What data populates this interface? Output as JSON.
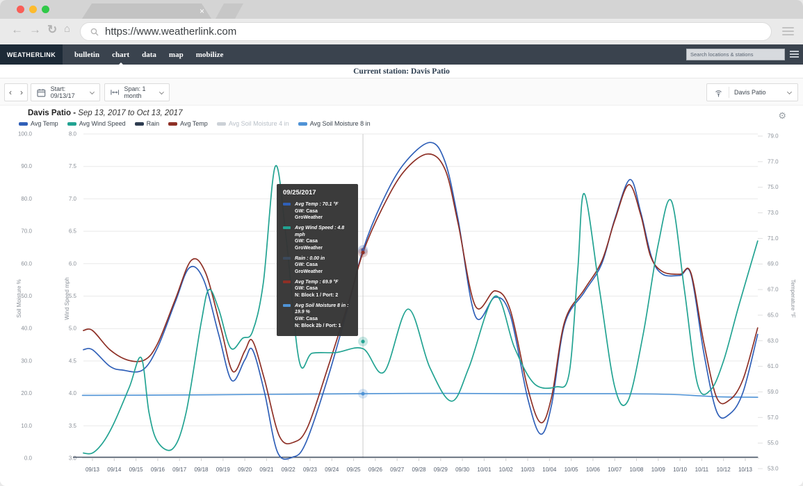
{
  "browser": {
    "url": "https://www.weatherlink.com",
    "tab_close": "×"
  },
  "nav": {
    "logo": "WEATHERLINK",
    "items": [
      {
        "label": "bulletin",
        "active": false
      },
      {
        "label": "chart",
        "active": true
      },
      {
        "label": "data",
        "active": false
      },
      {
        "label": "map",
        "active": false
      },
      {
        "label": "mobilize",
        "active": false
      }
    ],
    "search_placeholder": "Search locations & stations"
  },
  "station_bar": {
    "label": "Current station: Davis Patio"
  },
  "controls": {
    "prev": "‹",
    "next": "›",
    "start_label": "Start: 09/13/17",
    "span_label": "Span: 1 month",
    "station_label": "Davis Patio"
  },
  "chart_header": {
    "title": "Davis Patio - ",
    "subtitle": "Sep 13, 2017 to Oct 13, 2017",
    "gear": "⚙"
  },
  "legend": [
    {
      "label": "Avg Temp",
      "color": "#3060b8",
      "muted": false
    },
    {
      "label": "Avg Wind Speed",
      "color": "#22a392",
      "muted": false
    },
    {
      "label": "Rain",
      "color": "#2e3c50",
      "muted": false
    },
    {
      "label": "Avg Temp",
      "color": "#8e3026",
      "muted": false
    },
    {
      "label": "Avg Soil Moisture 4 in",
      "color": "#c6ccd3",
      "muted": true
    },
    {
      "label": "Avg Soil Moisture 8 in",
      "color": "#4f93d6",
      "muted": false
    }
  ],
  "tooltip": {
    "date": "09/25/2017",
    "entries": [
      {
        "color": "#3060b8",
        "label": "Avg Temp : 70.1 °F",
        "line2": "GW: Casa",
        "line3": "GroWeather"
      },
      {
        "color": "#22a392",
        "label": "Avg Wind Speed : 4.8 mph",
        "line2": "GW: Casa",
        "line3": "GroWeather"
      },
      {
        "color": "#3c4a5c",
        "label": "Rain : 0.00 in",
        "line2": "GW: Casa",
        "line3": "GroWeather"
      },
      {
        "color": "#8e3026",
        "label": "Avg Temp : 69.9 °F",
        "line2": "GW: Casa",
        "line3": "N: Block 1 / Port: 2"
      },
      {
        "color": "#4f93d6",
        "label": "Avg Soil Moisture 8 in : 19.9 %",
        "line2": "GW: Casa",
        "line3": "N: Block 2b / Port: 1"
      }
    ]
  },
  "chart_data": {
    "type": "line",
    "x_dates": [
      "09/13",
      "09/14",
      "09/15",
      "09/16",
      "09/17",
      "09/18",
      "09/19",
      "09/20",
      "09/21",
      "09/22",
      "09/23",
      "09/24",
      "09/25",
      "09/26",
      "09/27",
      "09/28",
      "09/29",
      "09/30",
      "10/01",
      "10/02",
      "10/03",
      "10/04",
      "10/05",
      "10/06",
      "10/07",
      "10/08",
      "10/09",
      "10/10",
      "10/11",
      "10/12",
      "10/13"
    ],
    "axes": {
      "soil": {
        "label": "Soil Moisture %",
        "range": [
          0,
          100
        ],
        "ticks": [
          "100.0",
          "90.0",
          "80.0",
          "70.0",
          "60.0",
          "50.0",
          "40.0",
          "30.0",
          "20.0",
          "10.0",
          "0.0"
        ]
      },
      "wind": {
        "label": "Wind Speed mph",
        "range": [
          3,
          8
        ],
        "ticks": [
          "8.0",
          "7.5",
          "7.0",
          "6.5",
          "6.0",
          "5.5",
          "5.0",
          "4.5",
          "4.0",
          "3.5",
          "3.0"
        ]
      },
      "temp": {
        "label": "Temperature °F",
        "range": [
          53,
          79
        ],
        "ticks": [
          "79.0",
          "77.0",
          "75.0",
          "73.0",
          "71.0",
          "69.0",
          "67.0",
          "65.0",
          "63.0",
          "61.0",
          "59.0",
          "57.0",
          "55.0",
          "53.0"
        ]
      }
    },
    "grid": true,
    "legend_position": "top-left",
    "series": [
      {
        "name": "Avg Soil Moisture 8 in",
        "axis": "soil",
        "color": "#4f93d6",
        "width": 1.6,
        "points": [
          [
            0,
            19.4
          ],
          [
            4,
            19.5
          ],
          [
            8,
            19.7
          ],
          [
            12.43,
            19.9
          ],
          [
            16,
            20.0
          ],
          [
            20,
            19.9
          ],
          [
            24,
            19.9
          ],
          [
            26.5,
            19.7
          ],
          [
            28,
            19.2
          ],
          [
            29,
            18.9
          ],
          [
            30.57,
            18.8
          ]
        ]
      },
      {
        "name": "Rain",
        "axis": "rain",
        "color": "#2e3c50",
        "width": 1.2,
        "points": [
          [
            0,
            0
          ],
          [
            10,
            0
          ],
          [
            20,
            0
          ],
          [
            30.57,
            0
          ]
        ]
      },
      {
        "name": "Avg Temp (GroWeather)",
        "axis": "temp",
        "color": "#3060b8",
        "width": 1.7,
        "points": [
          [
            0,
            62.3
          ],
          [
            0.8,
            61.0
          ],
          [
            1.4,
            60.7
          ],
          [
            2.3,
            60.7
          ],
          [
            3.0,
            62.5
          ],
          [
            3.8,
            66.0
          ],
          [
            4.45,
            68.7
          ],
          [
            5.1,
            67.8
          ],
          [
            5.8,
            63.5
          ],
          [
            6.4,
            59.9
          ],
          [
            7.0,
            61.5
          ],
          [
            7.35,
            62.3
          ],
          [
            7.9,
            59.0
          ],
          [
            8.5,
            54.3
          ],
          [
            9.2,
            53.9
          ],
          [
            9.8,
            55.0
          ],
          [
            10.8,
            60.0
          ],
          [
            11.8,
            66.0
          ],
          [
            12.43,
            70.1
          ],
          [
            13.3,
            73.8
          ],
          [
            14.3,
            76.8
          ],
          [
            15.5,
            78.5
          ],
          [
            16.2,
            77.0
          ],
          [
            16.8,
            72.5
          ],
          [
            17.6,
            64.9
          ],
          [
            18.5,
            66.4
          ],
          [
            19.2,
            65.0
          ],
          [
            20.0,
            58.5
          ],
          [
            20.6,
            55.7
          ],
          [
            21.1,
            58.0
          ],
          [
            21.7,
            64.3
          ],
          [
            22.6,
            66.8
          ],
          [
            23.4,
            69.0
          ],
          [
            24.0,
            72.5
          ],
          [
            24.7,
            75.6
          ],
          [
            25.2,
            73.0
          ],
          [
            25.7,
            69.5
          ],
          [
            26.2,
            68.2
          ],
          [
            27.0,
            68.1
          ],
          [
            27.5,
            68.2
          ],
          [
            28.1,
            62.0
          ],
          [
            28.7,
            57.4
          ],
          [
            29.3,
            57.3
          ],
          [
            29.9,
            59.0
          ],
          [
            30.57,
            63.5
          ]
        ]
      },
      {
        "name": "Avg Temp (Block 1)",
        "axis": "temp",
        "color": "#8e3026",
        "width": 1.7,
        "points": [
          [
            0,
            63.8
          ],
          [
            0.8,
            62.3
          ],
          [
            1.6,
            61.5
          ],
          [
            2.4,
            61.5
          ],
          [
            3.0,
            62.8
          ],
          [
            3.8,
            66.2
          ],
          [
            4.55,
            69.3
          ],
          [
            5.2,
            68.3
          ],
          [
            5.9,
            64.0
          ],
          [
            6.45,
            60.6
          ],
          [
            7.0,
            62.2
          ],
          [
            7.35,
            63.0
          ],
          [
            7.9,
            60.0
          ],
          [
            8.6,
            55.5
          ],
          [
            9.3,
            55.1
          ],
          [
            9.9,
            56.3
          ],
          [
            10.8,
            60.8
          ],
          [
            11.8,
            66.2
          ],
          [
            12.43,
            69.9
          ],
          [
            13.3,
            73.3
          ],
          [
            14.3,
            76.2
          ],
          [
            15.4,
            77.6
          ],
          [
            16.2,
            76.4
          ],
          [
            16.8,
            72.2
          ],
          [
            17.6,
            65.7
          ],
          [
            18.5,
            66.9
          ],
          [
            19.2,
            65.4
          ],
          [
            20.0,
            59.3
          ],
          [
            20.6,
            56.6
          ],
          [
            21.1,
            58.6
          ],
          [
            21.7,
            64.5
          ],
          [
            22.6,
            67.0
          ],
          [
            23.4,
            69.2
          ],
          [
            24.0,
            72.4
          ],
          [
            24.65,
            75.2
          ],
          [
            25.2,
            72.8
          ],
          [
            25.65,
            69.6
          ],
          [
            26.2,
            68.4
          ],
          [
            27.0,
            68.2
          ],
          [
            27.5,
            68.3
          ],
          [
            28.1,
            62.8
          ],
          [
            28.7,
            58.5
          ],
          [
            29.3,
            58.4
          ],
          [
            29.9,
            60.0
          ],
          [
            30.57,
            64.0
          ]
        ]
      },
      {
        "name": "Avg Wind Speed",
        "axis": "wind",
        "color": "#22a392",
        "width": 1.7,
        "points": [
          [
            0,
            3.08
          ],
          [
            0.5,
            3.25
          ],
          [
            1.0,
            3.55
          ],
          [
            1.7,
            4.1
          ],
          [
            2.24,
            4.55
          ],
          [
            2.6,
            3.7
          ],
          [
            3.0,
            3.25
          ],
          [
            3.7,
            3.15
          ],
          [
            4.3,
            3.7
          ],
          [
            5.0,
            5.1
          ],
          [
            5.35,
            5.6
          ],
          [
            5.8,
            5.3
          ],
          [
            6.35,
            4.7
          ],
          [
            6.9,
            4.85
          ],
          [
            7.35,
            4.95
          ],
          [
            7.85,
            5.7
          ],
          [
            8.4,
            7.5
          ],
          [
            8.9,
            6.4
          ],
          [
            9.5,
            4.5
          ],
          [
            10.1,
            4.62
          ],
          [
            11.2,
            4.63
          ],
          [
            12.43,
            4.69
          ],
          [
            13.4,
            4.33
          ],
          [
            14.5,
            5.3
          ],
          [
            15.5,
            4.4
          ],
          [
            16.5,
            3.88
          ],
          [
            17.3,
            4.4
          ],
          [
            18.5,
            5.5
          ],
          [
            19.4,
            4.7
          ],
          [
            20.3,
            4.15
          ],
          [
            21.3,
            4.1
          ],
          [
            21.9,
            4.3
          ],
          [
            22.3,
            5.9
          ],
          [
            22.6,
            7.08
          ],
          [
            23.3,
            5.6
          ],
          [
            24.0,
            4.1
          ],
          [
            24.6,
            3.88
          ],
          [
            25.3,
            4.9
          ],
          [
            26.0,
            6.3
          ],
          [
            26.6,
            6.97
          ],
          [
            27.2,
            5.6
          ],
          [
            27.8,
            4.15
          ],
          [
            28.4,
            4.05
          ],
          [
            29.0,
            4.5
          ],
          [
            29.7,
            5.35
          ],
          [
            30.57,
            6.35
          ]
        ]
      }
    ],
    "crosshair": {
      "x_day": 12.43,
      "markers": [
        {
          "axis": "temp",
          "value": 70.1,
          "color": "#3060b8"
        },
        {
          "axis": "temp",
          "value": 69.9,
          "color": "#8e3026"
        },
        {
          "axis": "wind",
          "value": 4.8,
          "color": "#22a392"
        },
        {
          "axis": "soil",
          "value": 19.9,
          "color": "#4f93d6"
        }
      ]
    }
  }
}
